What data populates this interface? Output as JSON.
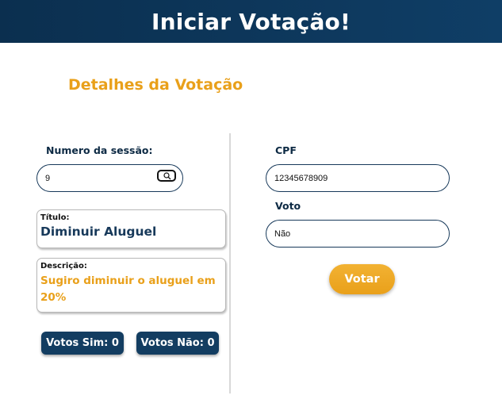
{
  "header": {
    "title": "Iniciar Votação!"
  },
  "details": {
    "title": "Detalhes da Votação",
    "session_label": "Numero da sessão:",
    "session_value": "9",
    "titulo_label": "Título:",
    "titulo_value": "Diminuir Aluguel",
    "descricao_label": "Descrição:",
    "descricao_value": "Sugiro diminuir o aluguel em 20%",
    "votos_sim": "Votos Sim: 0",
    "votos_nao": "Votos Não: 0"
  },
  "vote_form": {
    "cpf_label": "CPF",
    "cpf_value": "12345678909",
    "voto_label": "Voto",
    "voto_value": "Não",
    "submit_label": "Votar"
  },
  "colors": {
    "header_bg": "#0b2f4f",
    "accent": "#e9a01a",
    "navy": "#17395a"
  },
  "icons": {
    "search": "search-icon"
  }
}
